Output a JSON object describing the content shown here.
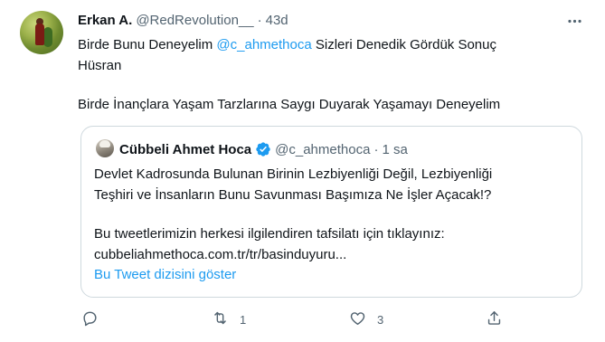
{
  "tweet": {
    "author_name": "Erkan A.",
    "author_handle": "@RedRevolution__",
    "separator": "·",
    "time": "43d",
    "more_icon": "more-icon",
    "text": {
      "line1_pre": "Birde Bunu Deneyelim ",
      "line1_mention": "@c_ahmethoca",
      "line1_post": " Sizleri Denedik Gördük Sonuç",
      "line2": "Hüsran",
      "line3": "Birde İnançlara Yaşam Tarzlarına Saygı Duyarak Yaşamayı Deneyelim"
    }
  },
  "quote": {
    "author_name": "Cübbeli Ahmet Hoca",
    "verified_icon": "verified-badge-icon",
    "author_handle": "@c_ahmethoca",
    "separator": "·",
    "time": "1 sa",
    "lines": [
      "Devlet Kadrosunda Bulunan Birinin Lezbiyenliği Değil, Lezbiyenliği",
      "Teşhiri ve İnsanların Bunu Savunması Başımıza Ne İşler Açacak!?",
      "Bu tweetlerimizin herkesi ilgilendiren tafsilatı için tıklayınız:",
      "cubbeliahmethoca.com.tr/tr/basinduyuru..."
    ],
    "thread_link": "Bu Tweet dizisini göster"
  },
  "actions": {
    "reply_count": "",
    "retweet_count": "1",
    "like_count": "3"
  },
  "colors": {
    "accent": "#1d9bf0",
    "secondary_text": "#536471",
    "border": "#cfd9de"
  }
}
